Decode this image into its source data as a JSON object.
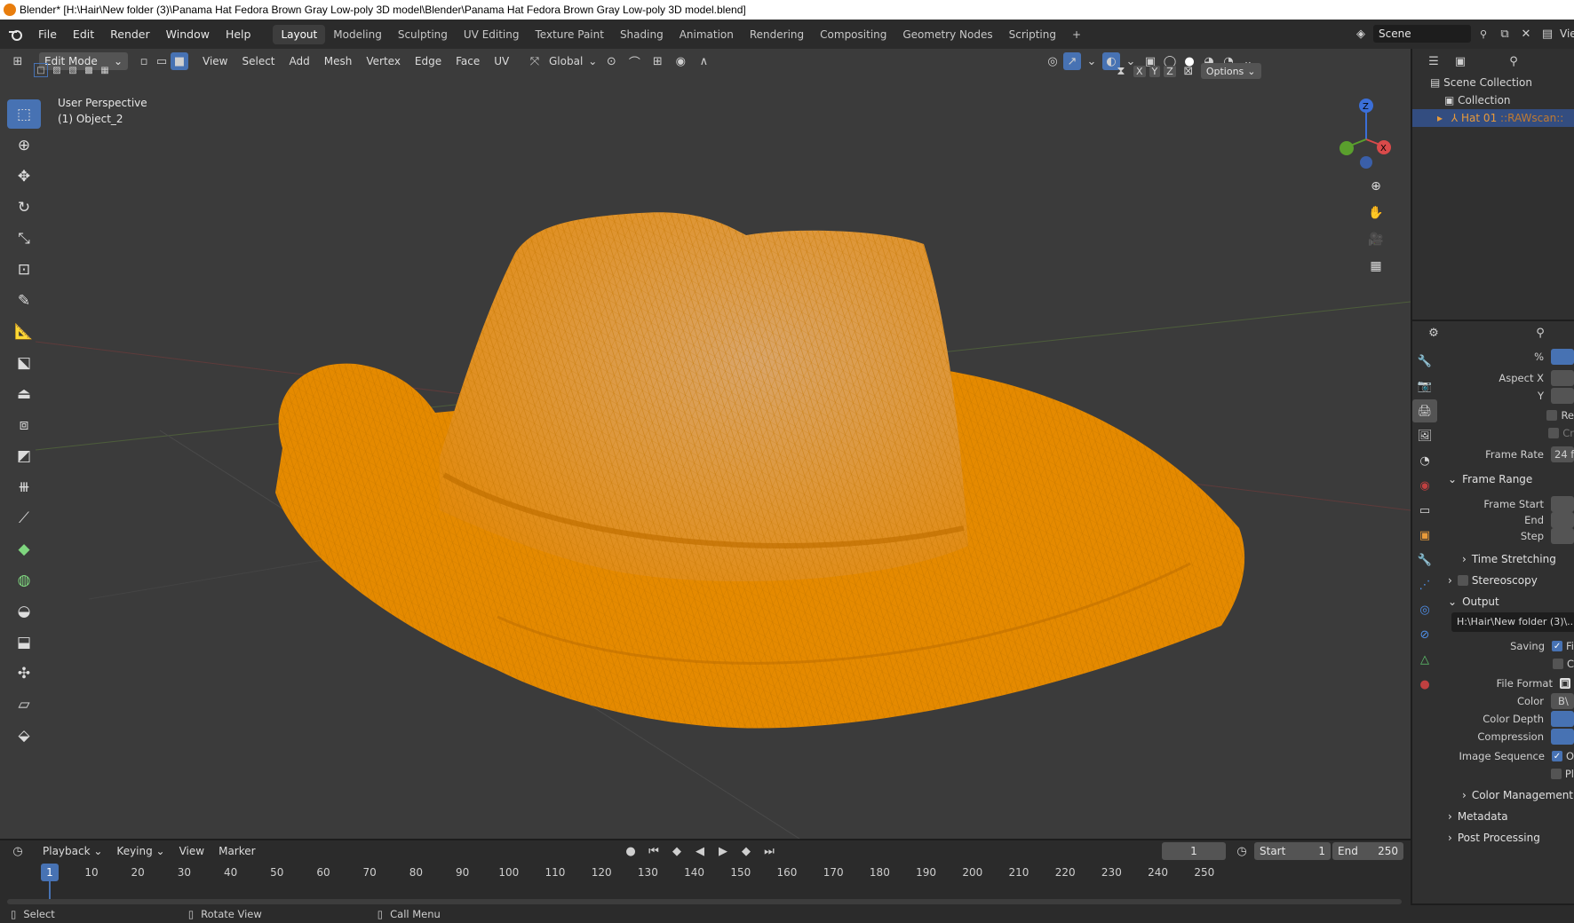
{
  "window": {
    "title": "Blender* [H:\\Hair\\New folder (3)\\Panama Hat Fedora Brown Gray Low-poly 3D model\\Blender\\Panama Hat Fedora Brown Gray Low-poly 3D model.blend]"
  },
  "menu": [
    "File",
    "Edit",
    "Render",
    "Window",
    "Help"
  ],
  "workspaces": [
    "Layout",
    "Modeling",
    "Sculpting",
    "UV Editing",
    "Texture Paint",
    "Shading",
    "Animation",
    "Rendering",
    "Compositing",
    "Geometry Nodes",
    "Scripting"
  ],
  "active_workspace": "Layout",
  "scene": {
    "name": "Scene",
    "view_layer_fragment": "Vie"
  },
  "viewport": {
    "mode": "Edit Mode",
    "menus": [
      "View",
      "Select",
      "Add",
      "Mesh",
      "Vertex",
      "Edge",
      "Face",
      "UV"
    ],
    "transform_orientation": "Global",
    "options_label": "Options",
    "axes": [
      "X",
      "Y",
      "Z"
    ],
    "overlay_line1": "User Perspective",
    "overlay_line2": "(1) Object_2",
    "mesh_color": "#e58a00",
    "background_color": "#3b3b3b"
  },
  "gizmo": {
    "z": "Z",
    "x": "X",
    "y": "Y"
  },
  "outliner": {
    "scene_collection": "Scene Collection",
    "collection": "Collection",
    "object": "Hat 01",
    "object_suffix": "::RAWscan::"
  },
  "properties": {
    "percent": "%",
    "aspect_x": "Aspect X",
    "aspect_y": "Y",
    "check1_fragment": "Re",
    "check2_fragment": "Cr",
    "frame_rate_label": "Frame Rate",
    "frame_rate_value": "24 f",
    "frame_range": "Frame Range",
    "frame_start": "Frame Start",
    "end": "End",
    "step": "Step",
    "time_stretching": "Time Stretching",
    "stereoscopy": "Stereoscopy",
    "output": "Output",
    "output_path": "H:\\Hair\\New folder (3)\\...t",
    "saving": "Saving",
    "saving_fragment1": "Fi",
    "saving_fragment2": "C",
    "file_format": "File Format",
    "color": "Color",
    "color_value": "B\\",
    "color_depth": "Color Depth",
    "compression": "Compression",
    "image_sequence": "Image Sequence",
    "seq_fragment1": "O",
    "seq_fragment2": "Pl",
    "color_management": "Color Management",
    "metadata": "Metadata",
    "post_processing": "Post Processing"
  },
  "timeline": {
    "menus": [
      "Playback",
      "Keying",
      "View",
      "Marker"
    ],
    "current_frame": "1",
    "start_label": "Start",
    "start_value": "1",
    "end_label": "End",
    "end_value": "250",
    "ticks": [
      "10",
      "20",
      "30",
      "40",
      "50",
      "60",
      "70",
      "80",
      "90",
      "100",
      "110",
      "120",
      "130",
      "140",
      "150",
      "160",
      "170",
      "180",
      "190",
      "200",
      "210",
      "220",
      "230",
      "240",
      "250"
    ],
    "playhead": "1"
  },
  "status": {
    "select": "Select",
    "rotate": "Rotate View",
    "call_menu": "Call Menu"
  }
}
